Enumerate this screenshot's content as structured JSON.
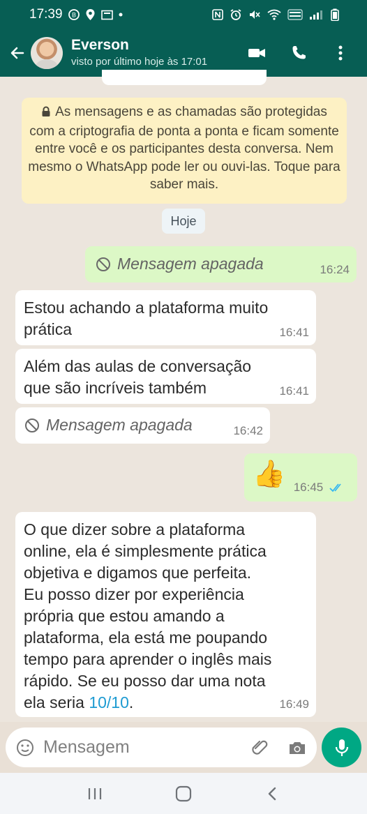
{
  "status_bar": {
    "time": "17:39"
  },
  "header": {
    "contact_name": "Everson",
    "last_seen": "visto por último hoje às 17:01"
  },
  "chat": {
    "notice_text": "As mensagens e as chamadas são protegidas com a criptografia de ponta a ponta e ficam somente entre você e os participantes desta conversa. Nem mesmo o WhatsApp pode ler ou ouvi-las. Toque para saber mais.",
    "day_label": "Hoje",
    "messages": [
      {
        "deleted_text": "Mensagem apagada",
        "time": "16:24"
      },
      {
        "text_line1": "Estou achando a plataforma muito",
        "text_line2": "prática",
        "time": "16:41"
      },
      {
        "text_line1": "Além das aulas de conversação",
        "text_line2": "que são incríveis também",
        "time": "16:41"
      },
      {
        "deleted_text": "Mensagem apagada",
        "time": "16:42"
      },
      {
        "emoji": "👍",
        "time": "16:45"
      },
      {
        "line1": "O que dizer sobre a plataforma",
        "line2": "online, ela é simplesmente prática",
        "line3": "objetiva e digamos que perfeita.",
        "line4": "Eu posso dizer por experiência",
        "line5": "própria que estou amando a",
        "line6": "plataforma, ela está me poupando",
        "line7": "tempo para aprender o inglês mais",
        "line8": "rápido. Se eu posso dar uma nota",
        "line9_prefix": "ela seria ",
        "line9_link": "10/10",
        "line9_suffix": ".",
        "time": "16:49"
      }
    ]
  },
  "composer": {
    "placeholder": "Mensagem"
  },
  "colors": {
    "header": "#075e54",
    "outgoing_bubble": "#dcf8c6",
    "incoming_bubble": "#ffffff",
    "notice": "#fdf1c4",
    "mic": "#00a884",
    "read_ticks": "#34b7f1"
  }
}
